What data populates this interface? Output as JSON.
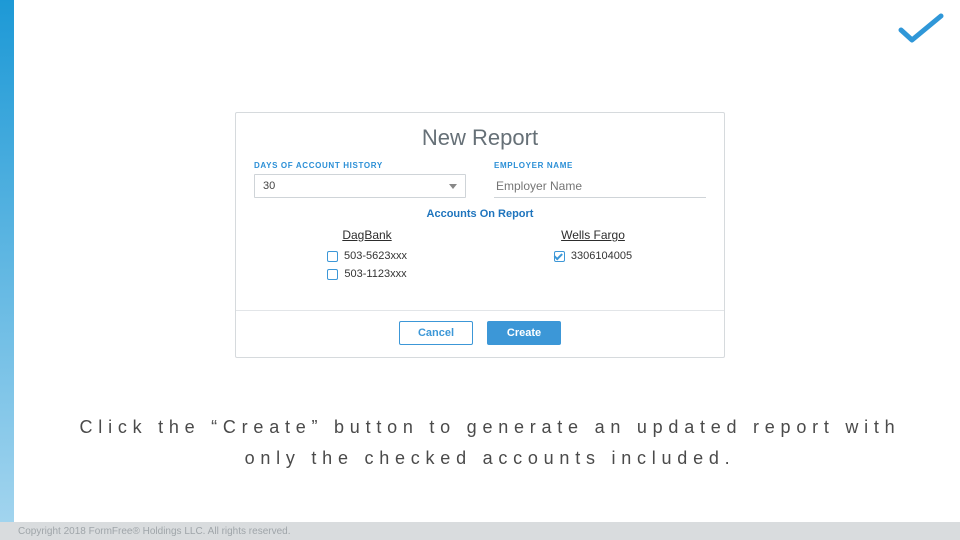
{
  "modal": {
    "title": "New Report",
    "days_label": "DAYS OF ACCOUNT HISTORY",
    "days_value": "30",
    "employer_label": "EMPLOYER NAME",
    "employer_placeholder": "Employer Name",
    "accounts_header": "Accounts On Report",
    "banks": [
      {
        "name": "DagBank",
        "accounts": [
          {
            "number": "503-5623xxx",
            "checked": false
          },
          {
            "number": "503-1123xxx",
            "checked": false
          }
        ]
      },
      {
        "name": "Wells Fargo",
        "accounts": [
          {
            "number": "3306104005",
            "checked": true
          }
        ]
      }
    ],
    "cancel_label": "Cancel",
    "create_label": "Create"
  },
  "instruction_text": "Click the “Create” button to generate an updated report with only the checked accounts included.",
  "footer_text": "Copyright 2018 FormFree® Holdings LLC. All rights reserved."
}
